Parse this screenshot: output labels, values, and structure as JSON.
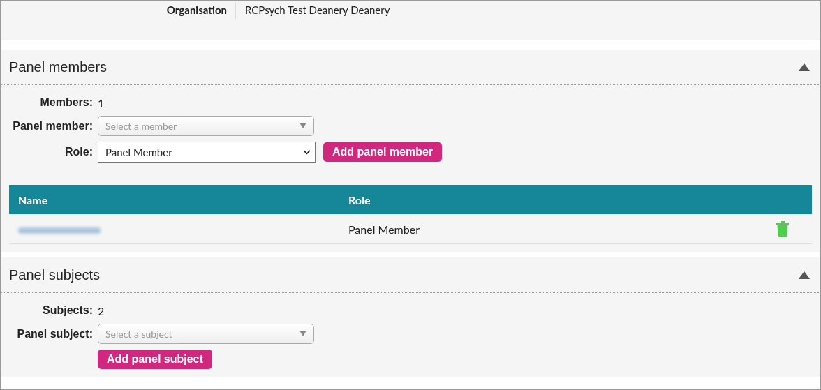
{
  "organisation": {
    "label": "Organisation",
    "value": "RCPsych Test Deanery Deanery"
  },
  "sections": [
    {
      "title": "Panel members",
      "expanded": true,
      "fields": [
        {
          "kind": "count",
          "label": "Members:",
          "value": "1"
        },
        {
          "kind": "combo",
          "label": "Panel member:",
          "placeholder": "Select a member"
        },
        {
          "kind": "select",
          "label": "Role:",
          "value": "Panel Member",
          "button": "Add panel member"
        }
      ],
      "table": {
        "columns": [
          "Name",
          "Role"
        ],
        "rows": [
          {
            "role": "Panel Member"
          }
        ]
      }
    },
    {
      "title": "Panel subjects",
      "expanded": true,
      "fields": [
        {
          "kind": "count",
          "label": "Subjects:",
          "value": "2"
        },
        {
          "kind": "combo",
          "label": "Panel subject:",
          "placeholder": "Select a subject"
        }
      ],
      "button": "Add panel subject"
    }
  ]
}
